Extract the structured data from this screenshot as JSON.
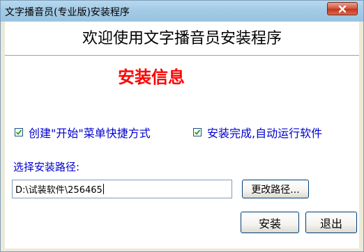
{
  "window": {
    "title": "文字播音员(专业版)安装程序",
    "close_icon": "close-icon"
  },
  "header": {
    "title": "欢迎使用文字播音员安装程序"
  },
  "section": {
    "title": "安装信息",
    "title_color": "#ff0000"
  },
  "options": {
    "start_menu_shortcut": {
      "label": "创建\"开始\"菜单快捷方式",
      "checked": true
    },
    "run_after_install": {
      "label": "安装完成,自动运行软件",
      "checked": true
    }
  },
  "path": {
    "label": "选择安装路径:",
    "value": "D:\\试装软件\\256465",
    "browse_label": "更改路径..."
  },
  "actions": {
    "install_label": "安装",
    "exit_label": "退出"
  },
  "colors": {
    "label_color": "#0000cc",
    "titlebar": "#a3cbe6",
    "close": "#c4361f"
  }
}
